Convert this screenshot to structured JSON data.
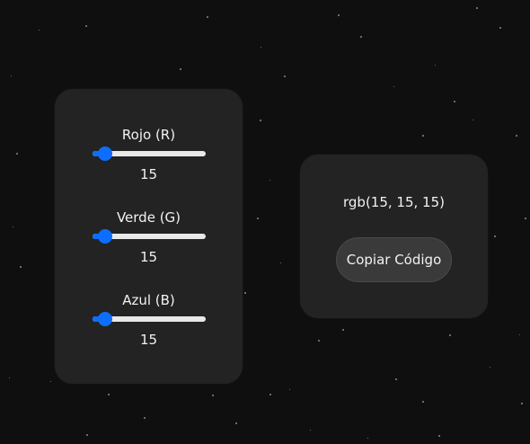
{
  "background": "#0f0f0f",
  "accent_color": "#0d6efd",
  "sliders": [
    {
      "label": "Rojo (R)",
      "value": "15",
      "min": 0,
      "max": 255,
      "level": 15
    },
    {
      "label": "Verde (G)",
      "value": "15",
      "min": 0,
      "max": 255,
      "level": 15
    },
    {
      "label": "Azul (B)",
      "value": "15",
      "min": 0,
      "max": 255,
      "level": 15
    }
  ],
  "output": {
    "rgb_text": "rgb(15, 15, 15)",
    "copy_button_label": "Copiar Código"
  }
}
